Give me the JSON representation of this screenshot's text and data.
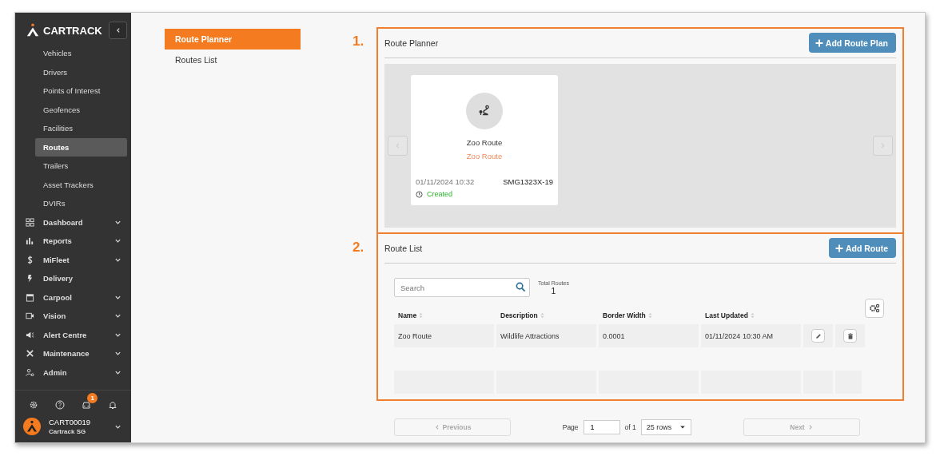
{
  "sidebar": {
    "brand": "CARTRACK",
    "sub_items": [
      {
        "label": "Vehicles",
        "selected": false
      },
      {
        "label": "Drivers",
        "selected": false
      },
      {
        "label": "Points of Interest",
        "selected": false
      },
      {
        "label": "Geofences",
        "selected": false
      },
      {
        "label": "Facilities",
        "selected": false
      },
      {
        "label": "Routes",
        "selected": true
      },
      {
        "label": "Trailers",
        "selected": false
      },
      {
        "label": "Asset Trackers",
        "selected": false
      },
      {
        "label": "DVIRs",
        "selected": false
      }
    ],
    "menu_items": [
      {
        "label": "Dashboard",
        "expandable": true
      },
      {
        "label": "Reports",
        "expandable": true
      },
      {
        "label": "MiFleet",
        "expandable": true
      },
      {
        "label": "Delivery",
        "expandable": false
      },
      {
        "label": "Carpool",
        "expandable": true
      },
      {
        "label": "Vision",
        "expandable": true
      },
      {
        "label": "Alert Centre",
        "expandable": true
      },
      {
        "label": "Maintenance",
        "expandable": true
      },
      {
        "label": "Admin",
        "expandable": true
      }
    ],
    "toolbar_badge": "1",
    "user": {
      "account": "CART00019",
      "company": "Cartrack SG"
    }
  },
  "subnav": [
    {
      "label": "Route Planner",
      "selected": true
    },
    {
      "label": "Routes List",
      "selected": false
    }
  ],
  "annotations": [
    "1.",
    "2."
  ],
  "route_planner": {
    "title": "Route Planner",
    "add_button": "Add Route Plan",
    "cards": [
      {
        "title": "Zoo Route",
        "subtitle": "Zoo Route",
        "date": "01/11/2024 10:32",
        "vehicle": "SMG1323X-19",
        "status": "Created"
      }
    ]
  },
  "route_list": {
    "title": "Route List",
    "add_button": "Add Route",
    "search_placeholder": "Search",
    "total_label": "Total Routes",
    "total_value": "1",
    "columns": [
      "Name",
      "Description",
      "Border Width",
      "Last Updated"
    ],
    "rows": [
      [
        "Zoo Route",
        "Wildlife Attractions",
        "0.0001",
        "01/11/2024 10:30 AM"
      ]
    ],
    "pagination": {
      "previous": "Previous",
      "page_label": "Page",
      "page_value": "1",
      "of_label": "of 1",
      "rows_option": "25 rows",
      "next": "Next"
    }
  }
}
